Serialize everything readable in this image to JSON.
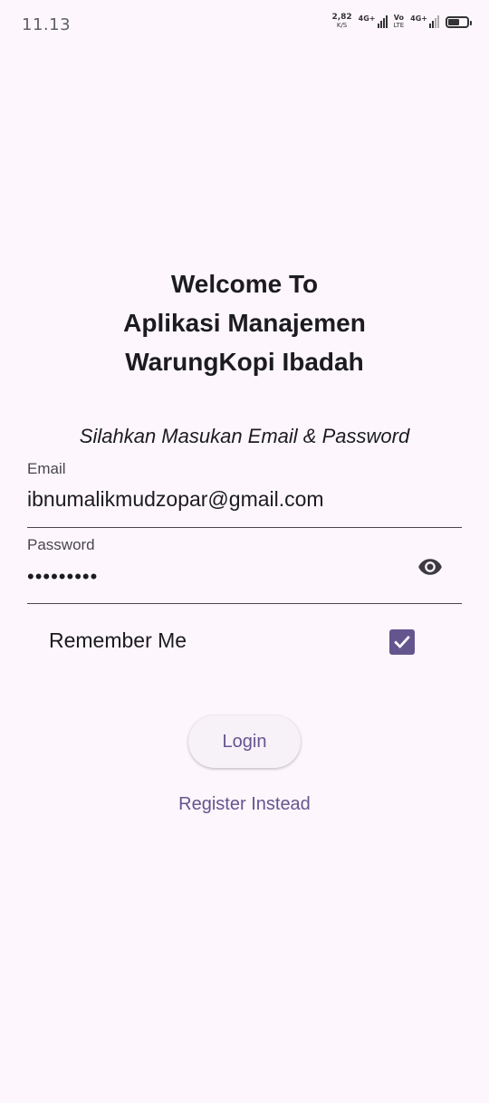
{
  "status_bar": {
    "time": "11.13",
    "net_speed_value": "2,82",
    "net_speed_unit": "K/S",
    "signal1_label": "4G+",
    "volte_top": "Vo",
    "volte_bottom": "LTE",
    "signal2_label": "4G+",
    "battery_level": 0.6
  },
  "header": {
    "title_line1": "Welcome To",
    "title_line2": "Aplikasi Manajemen",
    "title_line3": "WarungKopi Ibadah",
    "subtitle": "Silahkan Masukan Email & Password"
  },
  "form": {
    "email_label": "Email",
    "email_value": "ibnumalikmudzopar@gmail.com",
    "password_label": "Password",
    "password_value": "•••••••••",
    "password_toggle_icon": "eye-icon",
    "remember_label": "Remember Me",
    "remember_checked": true
  },
  "actions": {
    "login_label": "Login",
    "register_label": "Register Instead"
  },
  "colors": {
    "background": "#fdf7fd",
    "primary": "#65558f",
    "text": "#1c1b1f",
    "label": "#49454f"
  }
}
